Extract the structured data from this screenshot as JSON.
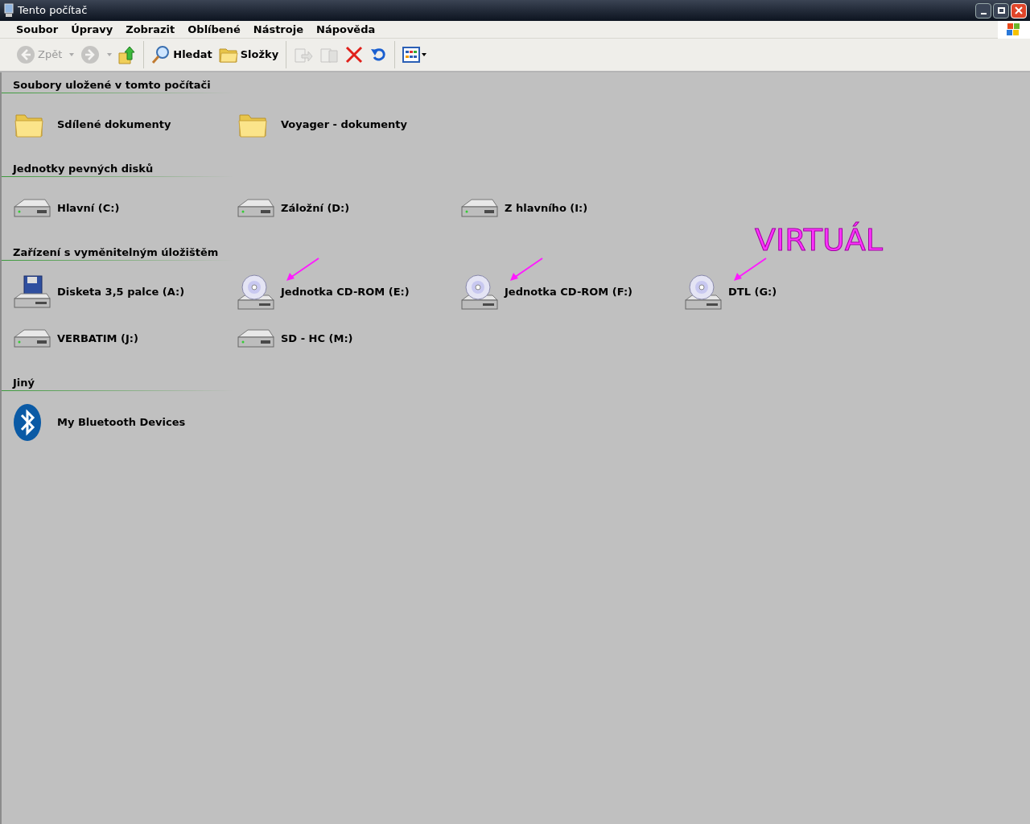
{
  "window": {
    "title": "Tento počítač"
  },
  "menu": [
    "Soubor",
    "Úpravy",
    "Zobrazit",
    "Oblíbené",
    "Nástroje",
    "Nápověda"
  ],
  "toolbar": [
    {
      "kind": "back",
      "label": "Zpět",
      "disabled": true
    },
    {
      "kind": "forward",
      "disabled": true
    },
    {
      "kind": "up",
      "disabled": false
    },
    {
      "kind": "search",
      "label": "Hledat",
      "disabled": false
    },
    {
      "kind": "folders",
      "label": "Složky",
      "disabled": false
    },
    {
      "kind": "move",
      "disabled": true
    },
    {
      "kind": "copy",
      "disabled": true
    },
    {
      "kind": "delete",
      "disabled": false
    },
    {
      "kind": "undo",
      "disabled": false
    },
    {
      "kind": "views",
      "disabled": false
    }
  ],
  "sections": [
    {
      "title": "Soubory uložené v tomto počítači",
      "items": [
        {
          "kind": "folder",
          "label": "Sdílené dokumenty",
          "arrow": false
        },
        {
          "kind": "folder",
          "label": "Voyager - dokumenty",
          "arrow": false
        }
      ]
    },
    {
      "title": "Jednotky pevných disků",
      "items": [
        {
          "kind": "hdd",
          "label": "Hlavní (C:)",
          "arrow": false
        },
        {
          "kind": "hdd",
          "label": "Záložní (D:)",
          "arrow": false
        },
        {
          "kind": "hdd",
          "label": "Z hlavního (I:)",
          "arrow": false
        }
      ]
    },
    {
      "title": "Zařízení s vyměnitelným úložištěm",
      "items": [
        {
          "kind": "floppy",
          "label": "Disketa 3,5 palce (A:)",
          "arrow": false
        },
        {
          "kind": "cd",
          "label": "Jednotka CD-ROM (E:)",
          "arrow": true
        },
        {
          "kind": "cd",
          "label": "Jednotka CD-ROM (F:)",
          "arrow": true
        },
        {
          "kind": "cd",
          "label": "DTL (G:)",
          "arrow": true,
          "note": "VIRTUÁL"
        },
        {
          "kind": "hdd",
          "label": "VERBATIM (J:)",
          "arrow": false
        },
        {
          "kind": "hdd",
          "label": "SD - HC (M:)",
          "arrow": false
        }
      ]
    },
    {
      "title": "Jiný",
      "items": [
        {
          "kind": "bluetooth",
          "label": "My Bluetooth Devices",
          "arrow": false
        }
      ]
    }
  ]
}
